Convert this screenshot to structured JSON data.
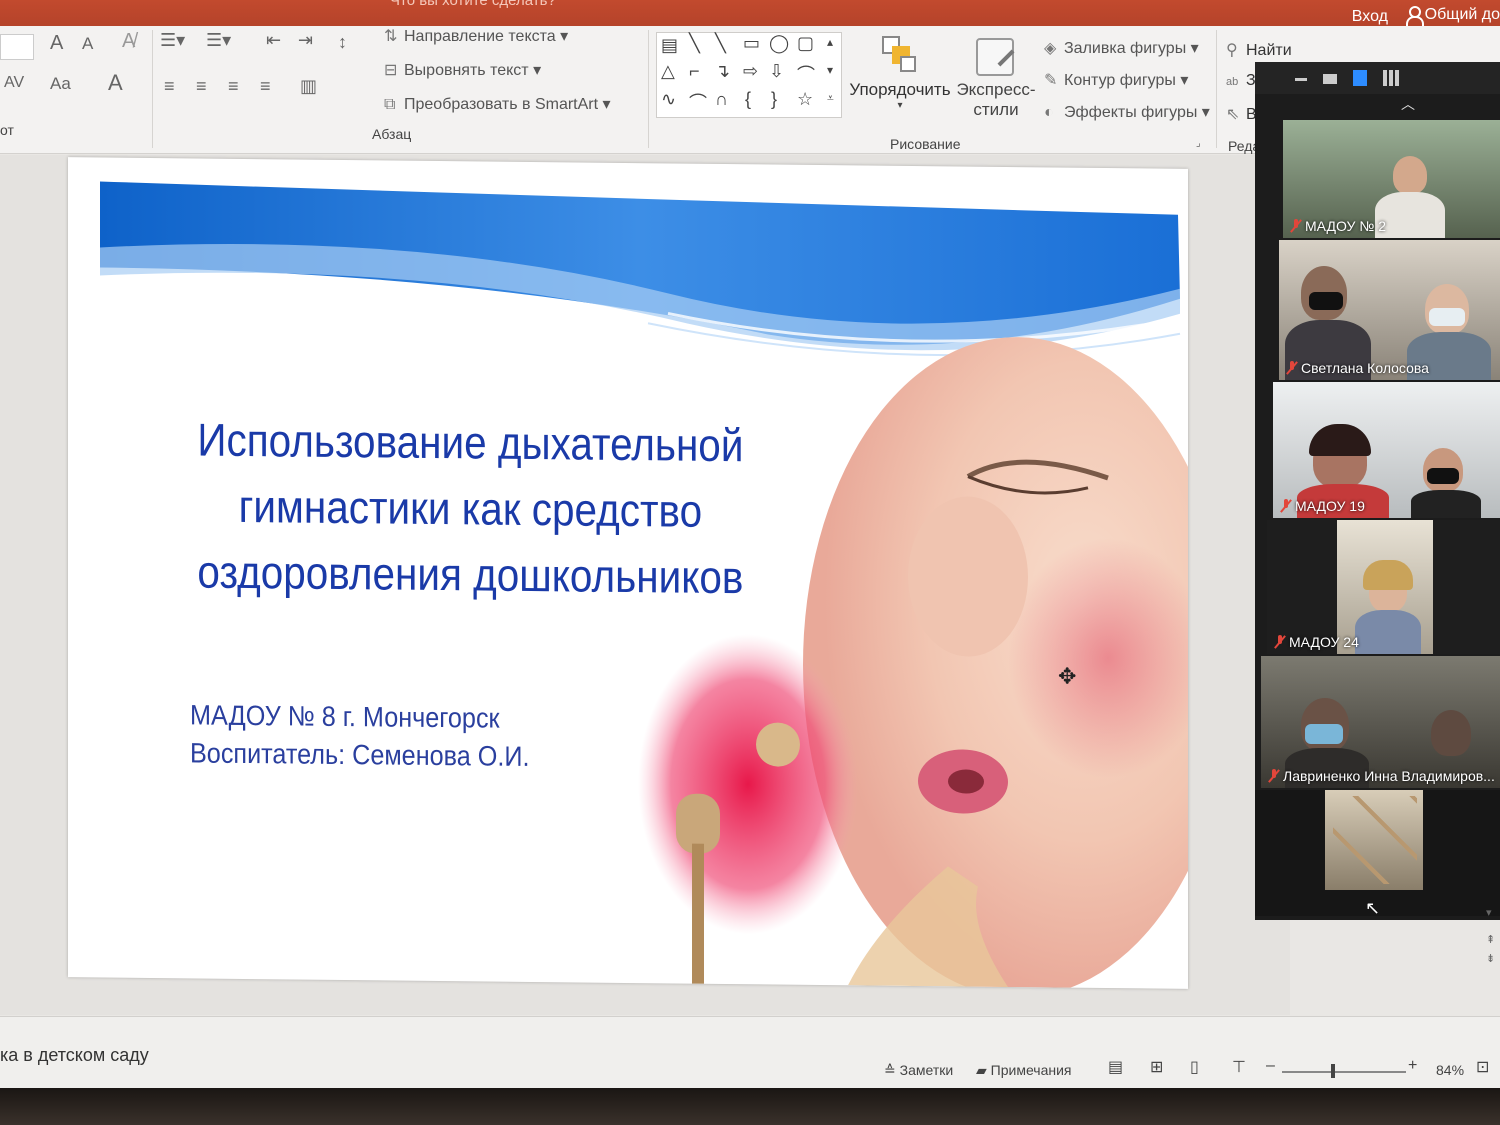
{
  "titlebar": {
    "ask_text": "Что вы хотите сделать?",
    "login": "Вход",
    "share": "Общий до"
  },
  "ribbon": {
    "font": {
      "grow_label": "A",
      "shrink_label": "A",
      "spacing_label": "AV",
      "case_label": "Aa",
      "color_label": "A",
      "group_label": "от"
    },
    "paragraph": {
      "text_direction": "Направление текста",
      "align_text": "Выровнять текст",
      "convert_smartart": "Преобразовать в SmartArt",
      "group_label": "Абзац"
    },
    "drawing": {
      "arrange": "Упорядочить",
      "quick_styles_1": "Экспресс-",
      "quick_styles_2": "стили",
      "shape_fill": "Заливка фигуры",
      "shape_outline": "Контур фигуры",
      "shape_effects": "Эффекты фигуры",
      "group_label": "Рисование"
    },
    "editing": {
      "find": "Найти",
      "replace": "Заме",
      "select": "Выд",
      "group_label": "Редакти"
    }
  },
  "slide": {
    "title_line1": "Использование дыхательной",
    "title_line2": "гимнастики как средство",
    "title_line3": "оздоровления дошкольников",
    "org_line": "МАДОУ № 8 г. Мончегорск",
    "teacher_line": "Воспитатель: Семенова О.И."
  },
  "gallery": {
    "participants": [
      {
        "name": "МАДОУ № 2"
      },
      {
        "name": "Светлана Колосова"
      },
      {
        "name": "МАДОУ 19"
      },
      {
        "name": "МАДОУ 24"
      },
      {
        "name": "Лавриненко Инна Владимиров..."
      }
    ]
  },
  "statusbar": {
    "doc_name": "ка в детском саду",
    "notes": "Заметки",
    "comments": "Примечания",
    "zoom_percent": "84%",
    "zoom_level": 0.84,
    "zoom_minus": "–",
    "zoom_plus": "+"
  },
  "colors": {
    "title_blue": "#1a3aa8",
    "ribbon_bg": "#f3f2f1",
    "titlebar_red": "#c24a2e",
    "gallery_bg": "#1c1c1c",
    "mic_muted": "#e2463b"
  }
}
